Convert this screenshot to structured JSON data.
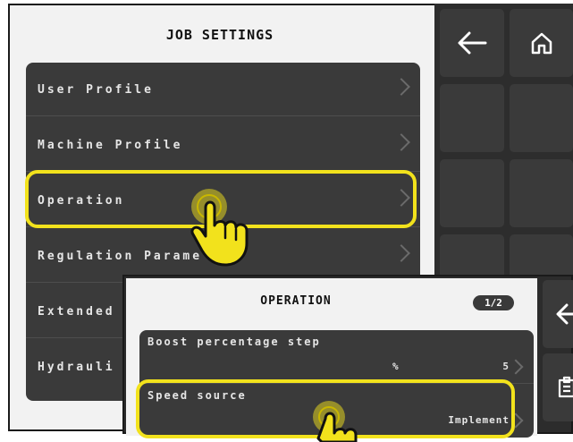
{
  "job_settings": {
    "title": "JOB SETTINGS",
    "items": [
      {
        "label": "User Profile"
      },
      {
        "label": "Machine Profile"
      },
      {
        "label": "Operation"
      },
      {
        "label": "Regulation Parame"
      },
      {
        "label": "Extended"
      },
      {
        "label": "Hydrauli"
      }
    ]
  },
  "nav": {
    "back_icon": "arrow-left-icon",
    "home_icon": "home-icon"
  },
  "operation": {
    "title": "OPERATION",
    "page": "1/2",
    "items": [
      {
        "label": "Boost percentage step",
        "unit": "%",
        "value": "5"
      },
      {
        "label": "Speed source",
        "value": "Implement"
      }
    ],
    "side_icons": [
      "arrow-left-icon",
      "clipboard-icon"
    ]
  },
  "colors": {
    "highlight": "#f2e21c",
    "panel": "#3a3a3a",
    "background": "#2d2d2d"
  }
}
